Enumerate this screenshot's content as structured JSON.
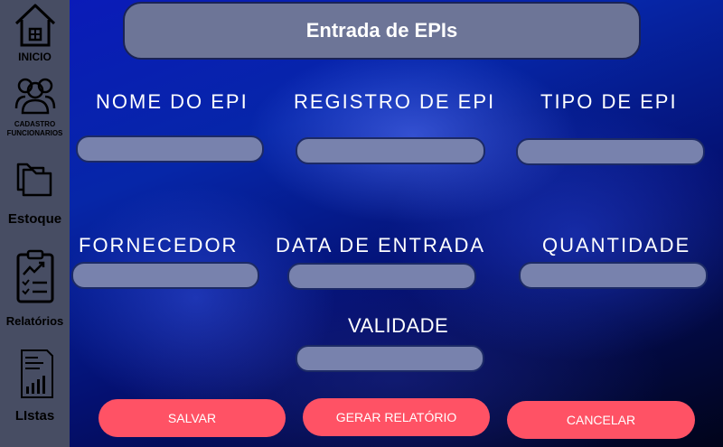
{
  "sidebar": {
    "items": [
      {
        "label": "INICIO",
        "icon": "house-icon"
      },
      {
        "label_line1": "CADASTRO",
        "label_line2": "FUNCIONARIOS",
        "icon": "users-icon"
      },
      {
        "label": "Estoque",
        "icon": "folders-icon"
      },
      {
        "label": "Relatórios",
        "icon": "clipboard-chart-icon"
      },
      {
        "label": "LIstas",
        "icon": "report-list-icon"
      }
    ]
  },
  "header": {
    "title": "Entrada de EPIs"
  },
  "form": {
    "nome_label": "NOME DO EPI",
    "registro_label": "REGISTRO DE EPI",
    "tipo_label": "TIPO DE EPI",
    "fornecedor_label": "FORNECEDOR",
    "data_label": "DATA DE ENTRADA",
    "quantidade_label": "QUANTIDADE",
    "validade_label": "VALIDADE"
  },
  "buttons": {
    "salvar": "SALVAR",
    "gerar": "GERAR RELATÓRIO",
    "cancelar": "CANCELAR"
  },
  "colors": {
    "sidebar": "#474d63",
    "button": "#ff5265",
    "field": "#7882ad",
    "header": "#6d7597"
  }
}
